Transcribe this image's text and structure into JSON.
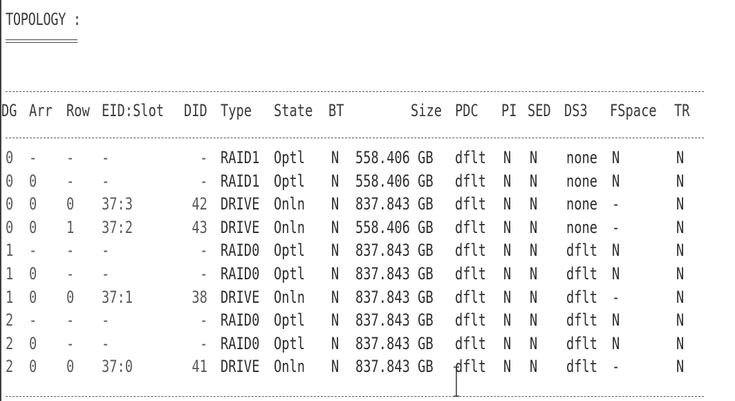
{
  "heading": "TOPOLOGY :",
  "columns": [
    "DG",
    "Arr",
    "Row",
    "EID:Slot",
    "DID",
    "Type",
    "State",
    "BT",
    "Size",
    "PDC",
    "PI",
    "SED",
    "DS3",
    "FSpace",
    "TR"
  ],
  "rows": [
    {
      "DG": "0",
      "Arr": "-",
      "Row": "-",
      "EIDSlot": "-",
      "DID": "-",
      "Type": "RAID1",
      "State": "Optl",
      "BT": "N",
      "Size": "558.406 GB",
      "PDC": "dflt",
      "PI": "N",
      "SED": "N",
      "DS3": "none",
      "FSpace": "N",
      "TR": "N"
    },
    {
      "DG": "0",
      "Arr": "0",
      "Row": "-",
      "EIDSlot": "-",
      "DID": "-",
      "Type": "RAID1",
      "State": "Optl",
      "BT": "N",
      "Size": "558.406 GB",
      "PDC": "dflt",
      "PI": "N",
      "SED": "N",
      "DS3": "none",
      "FSpace": "N",
      "TR": "N"
    },
    {
      "DG": "0",
      "Arr": "0",
      "Row": "0",
      "EIDSlot": "37:3",
      "DID": "42",
      "Type": "DRIVE",
      "State": "Onln",
      "BT": "N",
      "Size": "837.843 GB",
      "PDC": "dflt",
      "PI": "N",
      "SED": "N",
      "DS3": "none",
      "FSpace": "-",
      "TR": "N"
    },
    {
      "DG": "0",
      "Arr": "0",
      "Row": "1",
      "EIDSlot": "37:2",
      "DID": "43",
      "Type": "DRIVE",
      "State": "Onln",
      "BT": "N",
      "Size": "558.406 GB",
      "PDC": "dflt",
      "PI": "N",
      "SED": "N",
      "DS3": "none",
      "FSpace": "-",
      "TR": "N"
    },
    {
      "DG": "1",
      "Arr": "-",
      "Row": "-",
      "EIDSlot": "-",
      "DID": "-",
      "Type": "RAID0",
      "State": "Optl",
      "BT": "N",
      "Size": "837.843 GB",
      "PDC": "dflt",
      "PI": "N",
      "SED": "N",
      "DS3": "dflt",
      "FSpace": "N",
      "TR": "N"
    },
    {
      "DG": "1",
      "Arr": "0",
      "Row": "-",
      "EIDSlot": "-",
      "DID": "-",
      "Type": "RAID0",
      "State": "Optl",
      "BT": "N",
      "Size": "837.843 GB",
      "PDC": "dflt",
      "PI": "N",
      "SED": "N",
      "DS3": "dflt",
      "FSpace": "N",
      "TR": "N"
    },
    {
      "DG": "1",
      "Arr": "0",
      "Row": "0",
      "EIDSlot": "37:1",
      "DID": "38",
      "Type": "DRIVE",
      "State": "Onln",
      "BT": "N",
      "Size": "837.843 GB",
      "PDC": "dflt",
      "PI": "N",
      "SED": "N",
      "DS3": "dflt",
      "FSpace": "-",
      "TR": "N"
    },
    {
      "DG": "2",
      "Arr": "-",
      "Row": "-",
      "EIDSlot": "-",
      "DID": "-",
      "Type": "RAID0",
      "State": "Optl",
      "BT": "N",
      "Size": "837.843 GB",
      "PDC": "dflt",
      "PI": "N",
      "SED": "N",
      "DS3": "dflt",
      "FSpace": "N",
      "TR": "N"
    },
    {
      "DG": "2",
      "Arr": "0",
      "Row": "-",
      "EIDSlot": "-",
      "DID": "-",
      "Type": "RAID0",
      "State": "Optl",
      "BT": "N",
      "Size": "837.843 GB",
      "PDC": "dflt",
      "PI": "N",
      "SED": "N",
      "DS3": "dflt",
      "FSpace": "N",
      "TR": "N"
    },
    {
      "DG": "2",
      "Arr": "0",
      "Row": "0",
      "EIDSlot": "37:0",
      "DID": "41",
      "Type": "DRIVE",
      "State": "Onln",
      "BT": "N",
      "Size": "837.843 GB",
      "PDC": "dflt",
      "PI": "N",
      "SED": "N",
      "DS3": "dflt",
      "FSpace": "-",
      "TR": "N"
    }
  ],
  "icons": {
    "cursor": "text-cursor-icon"
  }
}
